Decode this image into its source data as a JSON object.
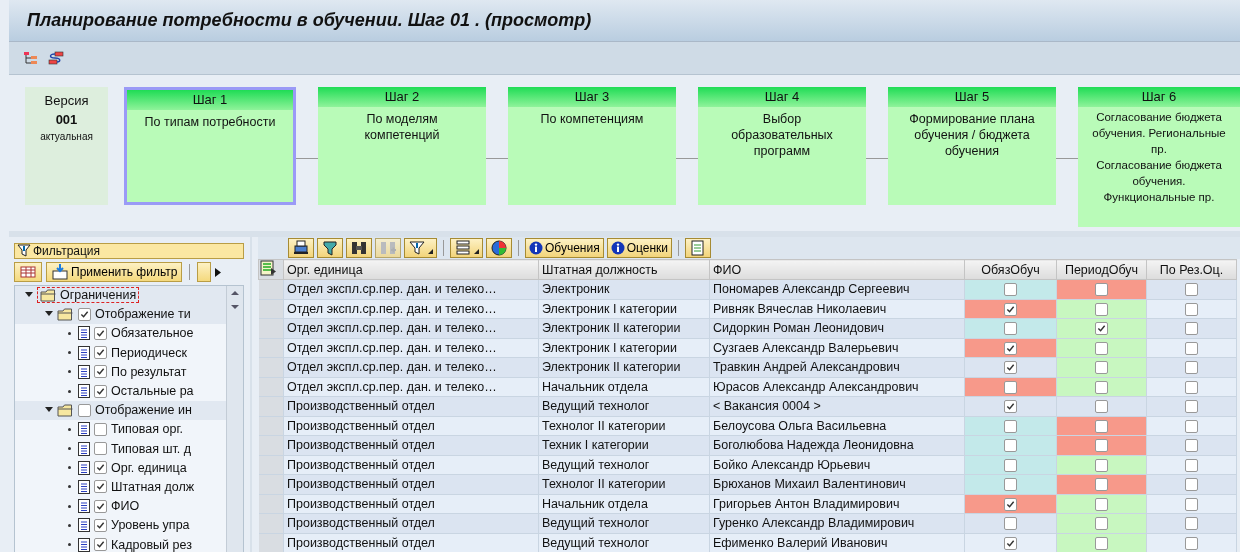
{
  "window": {
    "title": "Планирование потребности в обучении. Шаг 01 . (просмотр)"
  },
  "version": {
    "label": "Версия",
    "number": "001",
    "status": "актуальная"
  },
  "steps": [
    {
      "title": "Шаг 1",
      "texts": [
        "По типам потребности"
      ],
      "selected": true
    },
    {
      "title": "Шаг 2",
      "texts": [
        "По моделям компетенций"
      ],
      "selected": false
    },
    {
      "title": "Шаг 3",
      "texts": [
        "По компетенциям"
      ],
      "selected": false
    },
    {
      "title": "Шаг 4",
      "texts": [
        "Выбор образовательных программ"
      ],
      "selected": false
    },
    {
      "title": "Шаг 5",
      "texts": [
        "Формирование плана обучения / бюджета обучения"
      ],
      "selected": false
    },
    {
      "title": "Шаг 6",
      "texts": [
        "Согласование бюджета обучения. Региональные пр.",
        "Согласование бюджета обучения. Функциональные пр."
      ],
      "selected": false
    }
  ],
  "filter_panel": {
    "title": "Фильтрация",
    "apply_button": "Применить фильтр",
    "tree": [
      {
        "label": "Ограничения",
        "kind": "folder",
        "expanded": true,
        "children": [
          {
            "label": "Отображение ти",
            "kind": "folder",
            "expanded": true,
            "checked": true,
            "children": [
              {
                "label": "Обязательное",
                "kind": "doc",
                "checked": true
              },
              {
                "label": "Периодическ",
                "kind": "doc",
                "checked": true
              },
              {
                "label": "По результат",
                "kind": "doc",
                "checked": true
              },
              {
                "label": "Остальные ра",
                "kind": "doc",
                "checked": true
              }
            ]
          },
          {
            "label": "Отображение ин",
            "kind": "folder",
            "expanded": true,
            "checked": false,
            "children": [
              {
                "label": "Типовая орг.",
                "kind": "doc",
                "checked": false
              },
              {
                "label": "Типовая шт. д",
                "kind": "doc",
                "checked": false
              },
              {
                "label": "Орг. единица",
                "kind": "doc",
                "checked": true
              },
              {
                "label": "Штатная долж",
                "kind": "doc",
                "checked": true
              },
              {
                "label": "ФИО",
                "kind": "doc",
                "checked": true
              },
              {
                "label": "Уровень упра",
                "kind": "doc",
                "checked": true
              },
              {
                "label": "Кадровый рез",
                "kind": "doc",
                "checked": true
              }
            ]
          }
        ]
      }
    ]
  },
  "grid": {
    "buttons": [
      "Обучения",
      "Оценки"
    ],
    "columns": [
      "Орг. единица",
      "Штатная должность",
      "ФИО",
      "ОбязОбуч",
      "ПериодОбуч",
      "По Рез.Оц."
    ],
    "rows": [
      {
        "org": "Отдел экспл.ср.пер. дан. и телеко…",
        "position": "Электроник",
        "name": "Пономарев Александр Сергеевич",
        "flags": [
          {
            "checked": false,
            "color": "#c3e9ea"
          },
          {
            "checked": false,
            "color": "#f7998a"
          },
          {
            "checked": false
          }
        ]
      },
      {
        "org": "Отдел экспл.ср.пер. дан. и телеко…",
        "position": "Электроник I категории",
        "name": "Ривняк Вячеслав Николаевич",
        "flags": [
          {
            "checked": true,
            "color": "#f7998a"
          },
          {
            "checked": false,
            "color": "#c8f7c0"
          },
          {
            "checked": false
          }
        ]
      },
      {
        "org": "Отдел экспл.ср.пер. дан. и телеко…",
        "position": "Электроник II категории",
        "name": "Сидоркин Роман Леонидович",
        "flags": [
          {
            "checked": false,
            "color": "#c3e9ea"
          },
          {
            "checked": true,
            "color": "#c8f7c0"
          },
          {
            "checked": false
          }
        ]
      },
      {
        "org": "Отдел экспл.ср.пер. дан. и телеко…",
        "position": "Электроник I категории",
        "name": "Сузгаев Александр Валерьевич",
        "flags": [
          {
            "checked": true,
            "color": "#f7998a"
          },
          {
            "checked": false,
            "color": "#c8f7c0"
          },
          {
            "checked": false
          }
        ]
      },
      {
        "org": "Отдел экспл.ср.пер. дан. и телеко…",
        "position": "Электроник II категории",
        "name": "Травкин Андрей Александрович",
        "flags": [
          {
            "checked": true
          },
          {
            "checked": false,
            "color": "#c8f7c0"
          },
          {
            "checked": false
          }
        ]
      },
      {
        "org": "Отдел экспл.ср.пер. дан. и телеко…",
        "position": "Начальник отдела",
        "name": "Юрасов Александр Александрович",
        "flags": [
          {
            "checked": false,
            "color": "#f7998a"
          },
          {
            "checked": false,
            "color": "#c8f7c0"
          },
          {
            "checked": false
          }
        ]
      },
      {
        "org": "Производственный отдел",
        "position": "Ведущий технолог",
        "name": "< Вакансия 0004 >",
        "flags": [
          {
            "checked": true
          },
          {
            "checked": false
          },
          {
            "checked": false
          }
        ]
      },
      {
        "org": "Производственный отдел",
        "position": "Технолог II категории",
        "name": "Белоусова Ольга Васильевна",
        "flags": [
          {
            "checked": false,
            "color": "#c3e9ea"
          },
          {
            "checked": false,
            "color": "#f7998a"
          },
          {
            "checked": false
          }
        ]
      },
      {
        "org": "Производственный отдел",
        "position": "Техник I категории",
        "name": "Боголюбова Надежда Леонидовна",
        "flags": [
          {
            "checked": false,
            "color": "#c3e9ea"
          },
          {
            "checked": false,
            "color": "#f7998a"
          },
          {
            "checked": false
          }
        ]
      },
      {
        "org": "Производственный отдел",
        "position": "Ведущий технолог",
        "name": "Бойко Александр Юрьевич",
        "flags": [
          {
            "checked": false,
            "color": "#c3e9ea"
          },
          {
            "checked": false,
            "color": "#c8f7c0"
          },
          {
            "checked": false
          }
        ]
      },
      {
        "org": "Производственный отдел",
        "position": "Технолог II категории",
        "name": "Брюханов Михаил Валентинович",
        "flags": [
          {
            "checked": false,
            "color": "#c3e9ea"
          },
          {
            "checked": false,
            "color": "#f7998a"
          },
          {
            "checked": false
          }
        ]
      },
      {
        "org": "Производственный отдел",
        "position": "Начальник отдела",
        "name": "Григорьев Антон Владимирович",
        "flags": [
          {
            "checked": true,
            "color": "#f7998a"
          },
          {
            "checked": false,
            "color": "#c8f7c0"
          },
          {
            "checked": false
          }
        ]
      },
      {
        "org": "Производственный отдел",
        "position": "Ведущий технолог",
        "name": "Гуренко Александр Владимирович",
        "flags": [
          {
            "checked": false
          },
          {
            "checked": false,
            "color": "#c8f7c0"
          },
          {
            "checked": false
          }
        ]
      },
      {
        "org": "Производственный отдел",
        "position": "Ведущий технолог",
        "name": "Ефименко Валерий Иванович",
        "flags": [
          {
            "checked": true
          },
          {
            "checked": false,
            "color": "#c8f7c0"
          },
          {
            "checked": false
          }
        ]
      }
    ]
  }
}
